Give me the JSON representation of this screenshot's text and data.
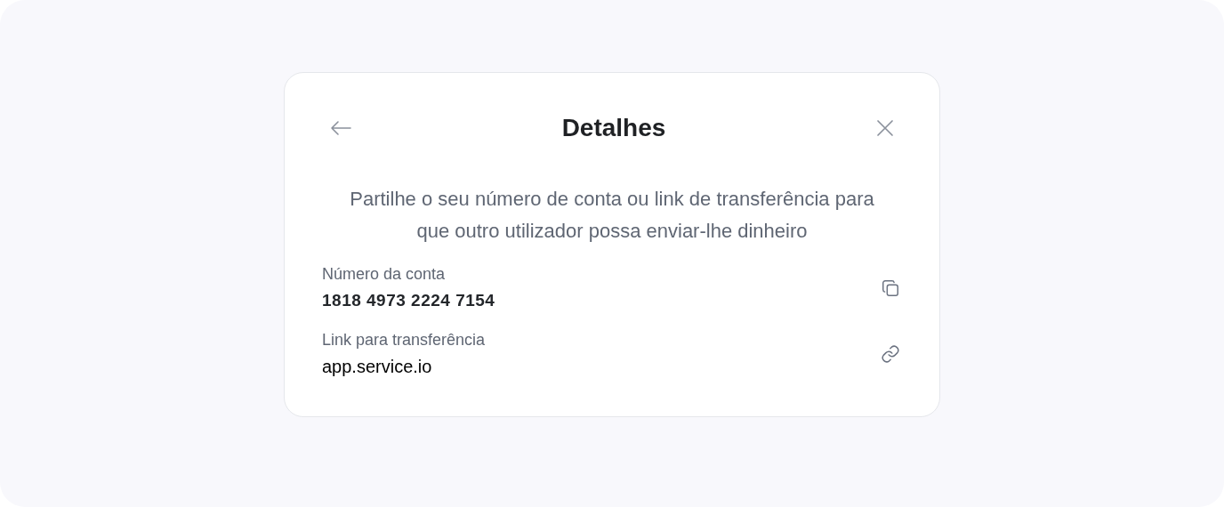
{
  "dialog": {
    "title": "Detalhes",
    "description": "Partilhe o seu número de conta ou link de transferência para que outro utilizador possa enviar-lhe dinheiro",
    "fields": [
      {
        "kind": "account",
        "label": "Número da conta",
        "value": "1818 4973 2224 7154"
      },
      {
        "kind": "link",
        "label": "Link para transferência",
        "value": "app.service.io"
      }
    ]
  }
}
